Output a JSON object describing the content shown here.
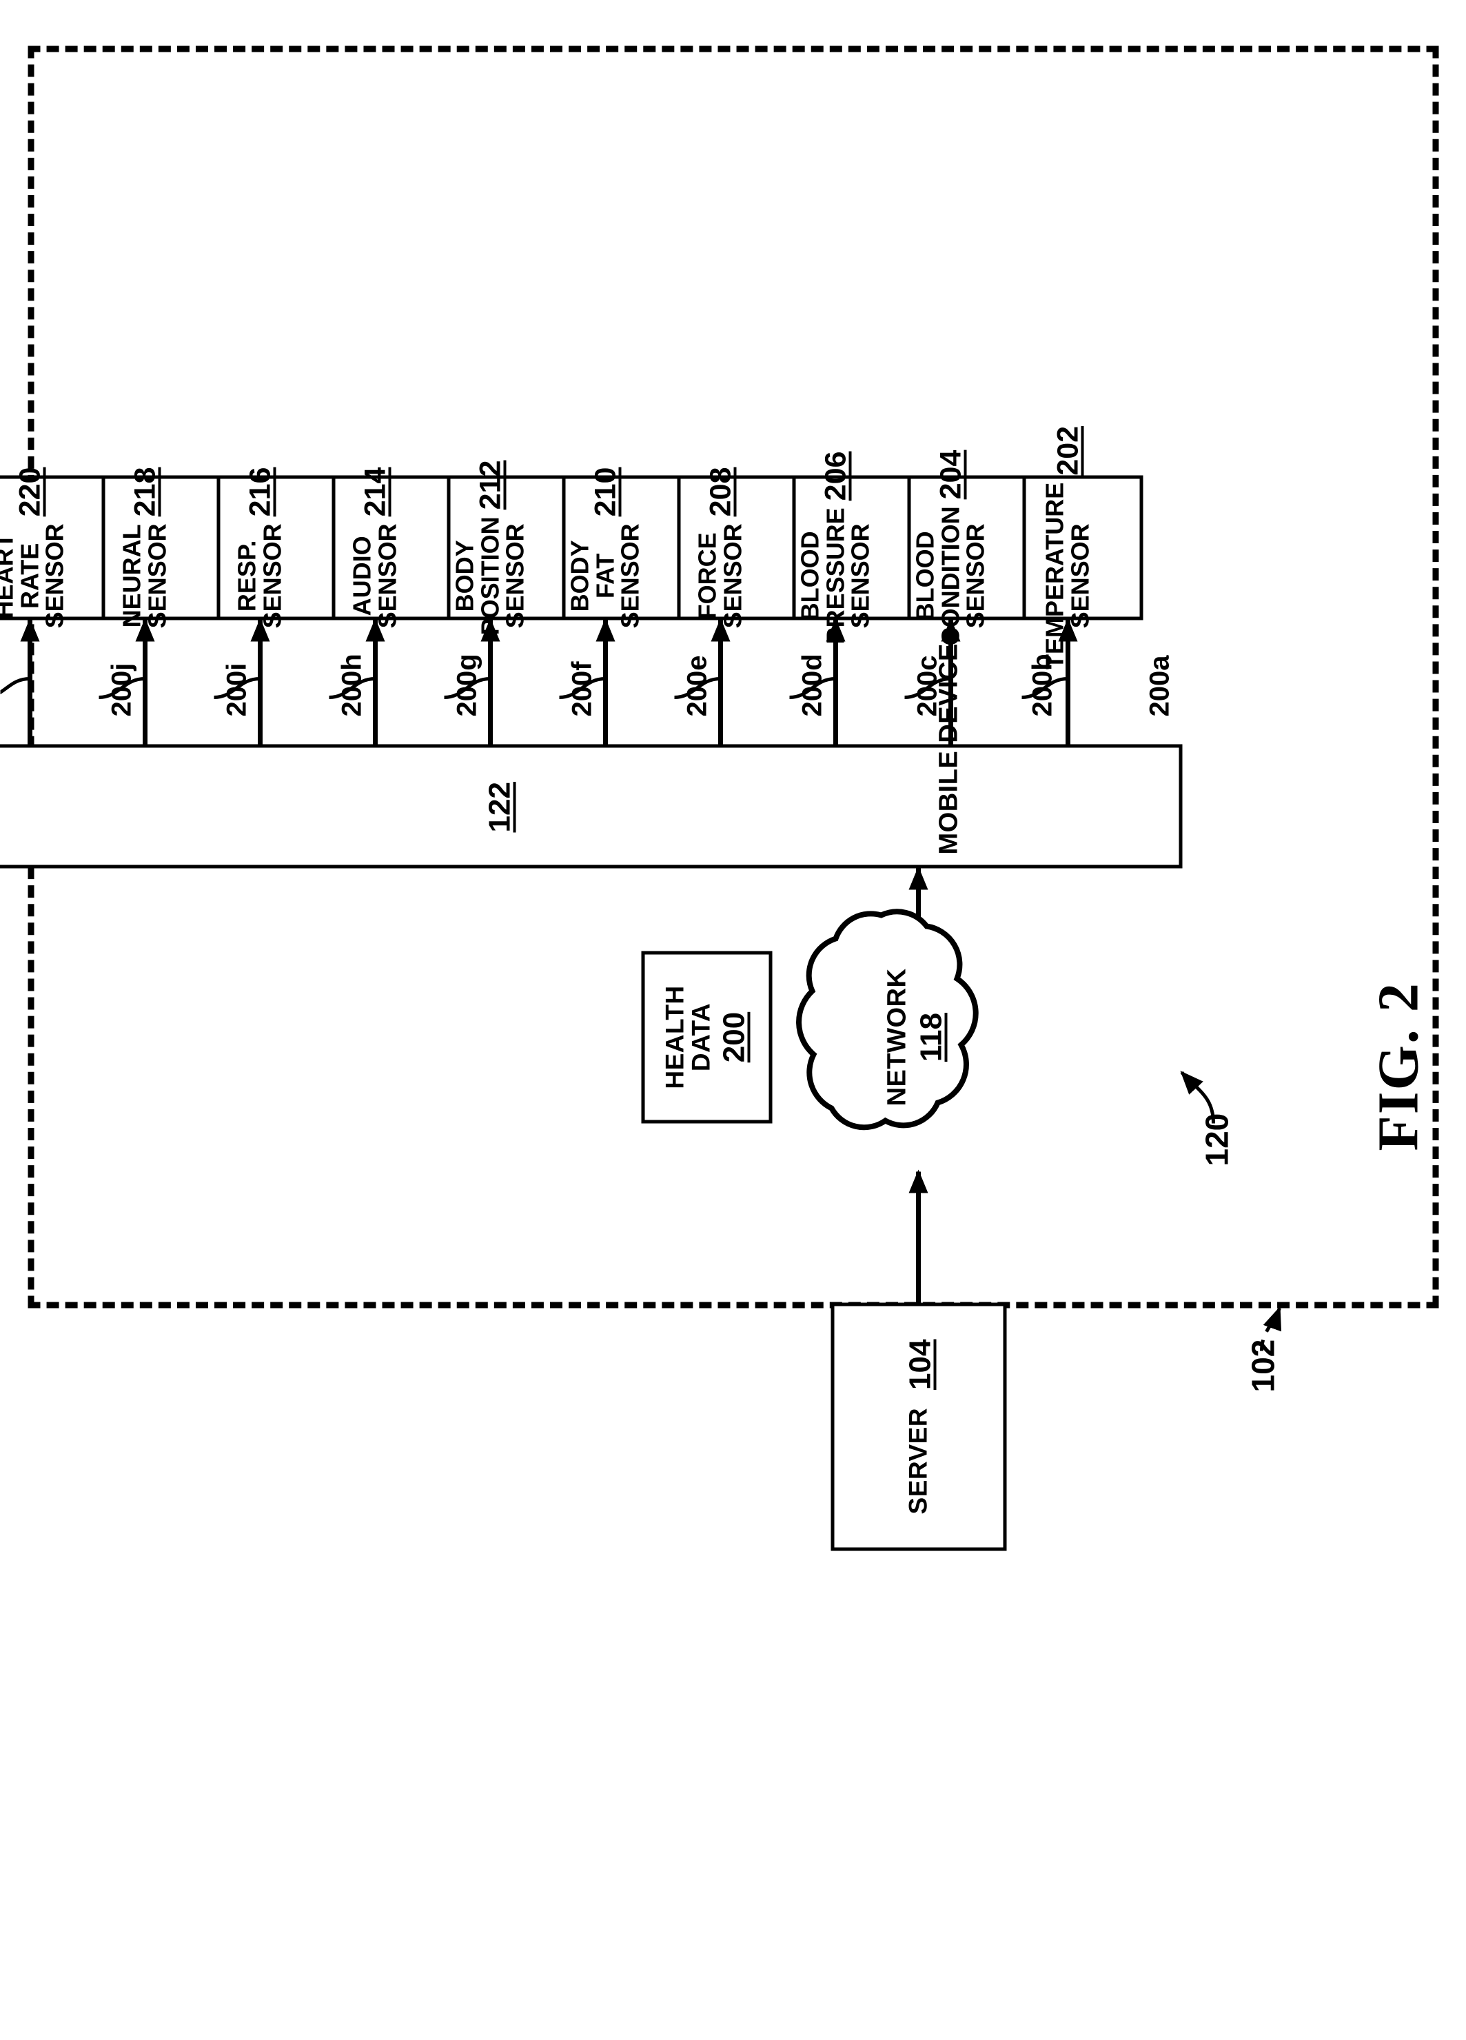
{
  "figure": {
    "label": "FIG. 2",
    "system_ref": "102",
    "device_group_ref": "120"
  },
  "server": {
    "name": "SERVER",
    "ref": "104"
  },
  "network": {
    "name": "NETWORK",
    "ref": "118"
  },
  "health_data": {
    "name": "HEALTH\nDATA",
    "ref": "200"
  },
  "mobile_device": {
    "name": "MOBILE DEVICE",
    "ref": "122"
  },
  "sensors": [
    {
      "name": "TEMPERATURE\nSENSOR",
      "ref": "202",
      "conn": "200a"
    },
    {
      "name": "BLOOD\nCONDITION\nSENSOR",
      "ref": "204",
      "conn": "200b"
    },
    {
      "name": "BLOOD\nPRESSURE\nSENSOR",
      "ref": "206",
      "conn": "200c"
    },
    {
      "name": "FORCE\nSENSOR",
      "ref": "208",
      "conn": "200d"
    },
    {
      "name": "BODY FAT\nSENSOR",
      "ref": "210",
      "conn": "200e"
    },
    {
      "name": "BODY\nPOSITION\nSENSOR",
      "ref": "212",
      "conn": "200f"
    },
    {
      "name": "AUDIO\nSENSOR",
      "ref": "214",
      "conn": "200g"
    },
    {
      "name": "RESP.\nSENSOR",
      "ref": "216",
      "conn": "200h"
    },
    {
      "name": "NEURAL\nSENSOR",
      "ref": "218",
      "conn": "200i"
    },
    {
      "name": "HEART\nRATE\nSENSOR",
      "ref": "220",
      "conn": "200j"
    }
  ],
  "colors": {
    "ink": "#000000",
    "paper": "#ffffff"
  }
}
